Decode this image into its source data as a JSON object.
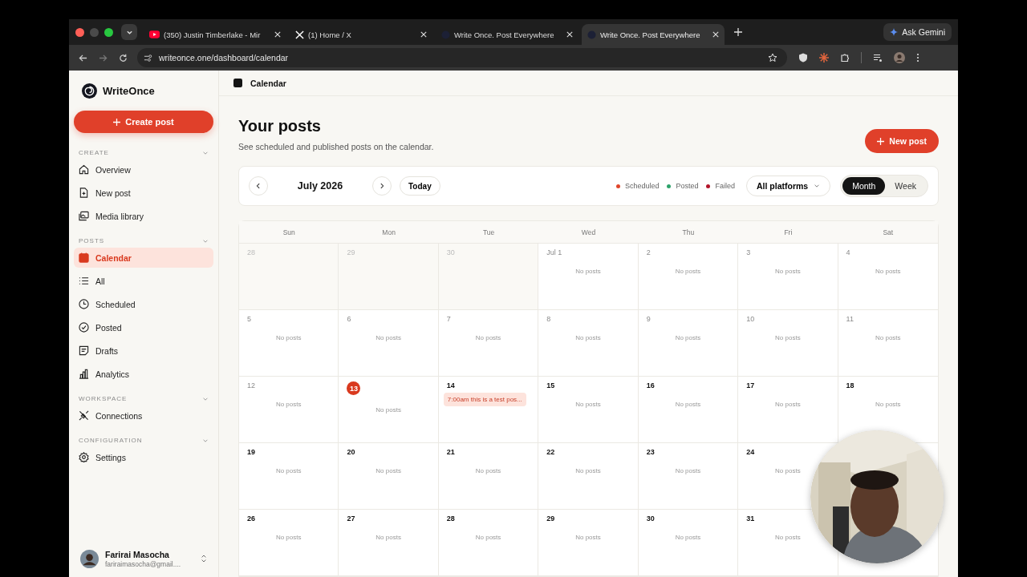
{
  "browser": {
    "tabs": [
      {
        "title": "(350) Justin Timberlake - Mir",
        "kind": "video",
        "selected": false
      },
      {
        "title": "(1) Home / X",
        "kind": "x",
        "selected": false
      },
      {
        "title": "Write Once. Post Everywhere",
        "kind": "app",
        "selected": false
      },
      {
        "title": "Write Once. Post Everywhere",
        "kind": "app",
        "selected": true
      }
    ],
    "gemini_button": "Ask Gemini",
    "url": "writeonce.one/dashboard/calendar"
  },
  "sidebar": {
    "brand": "WriteOnce",
    "create_button": "Create post",
    "sections": [
      {
        "title": "CREATE",
        "items": [
          {
            "label": "Overview",
            "selected": false
          },
          {
            "label": "New post",
            "selected": false
          },
          {
            "label": "Media library",
            "selected": false
          }
        ]
      },
      {
        "title": "POSTS",
        "items": [
          {
            "label": "Calendar",
            "selected": true
          },
          {
            "label": "All",
            "selected": false
          },
          {
            "label": "Scheduled",
            "selected": false
          },
          {
            "label": "Posted",
            "selected": false
          },
          {
            "label": "Drafts",
            "selected": false
          },
          {
            "label": "Analytics",
            "selected": false
          }
        ]
      },
      {
        "title": "WORKSPACE",
        "items": [
          {
            "label": "Connections",
            "selected": false
          }
        ]
      },
      {
        "title": "CONFIGURATION",
        "items": [
          {
            "label": "Settings",
            "selected": false
          }
        ]
      }
    ],
    "user": {
      "name": "Farirai Masocha",
      "email": "fariraimasocha@gmail...."
    }
  },
  "header": {
    "title": "Calendar"
  },
  "page": {
    "title": "Your posts",
    "subtitle": "See scheduled and published posts on the calendar.",
    "new_post_button": "New post"
  },
  "toolbar": {
    "month": "July 2026",
    "today_button": "Today",
    "legend": [
      {
        "label": "Scheduled",
        "color": "#e0452b"
      },
      {
        "label": "Posted",
        "color": "#2ea36b"
      },
      {
        "label": "Failed",
        "color": "#b3152a"
      }
    ],
    "platform_filter": "All platforms",
    "views": [
      {
        "label": "Month",
        "selected": true
      },
      {
        "label": "Week",
        "selected": false
      }
    ]
  },
  "calendar": {
    "weekdays": [
      "Sun",
      "Mon",
      "Tue",
      "Wed",
      "Thu",
      "Fri",
      "Sat"
    ],
    "weeks": [
      [
        {
          "day": "28",
          "outside_month": true
        },
        {
          "day": "29",
          "outside_month": true
        },
        {
          "day": "30",
          "outside_month": true
        },
        {
          "day": "Jul 1",
          "outside_month": false,
          "past": true,
          "empty_text": "No posts"
        },
        {
          "day": "2",
          "outside_month": false,
          "past": true,
          "empty_text": "No posts"
        },
        {
          "day": "3",
          "outside_month": false,
          "past": true,
          "empty_text": "No posts"
        },
        {
          "day": "4",
          "outside_month": false,
          "past": true,
          "empty_text": "No posts"
        }
      ],
      [
        {
          "day": "5",
          "outside_month": false,
          "past": true,
          "empty_text": "No posts"
        },
        {
          "day": "6",
          "outside_month": false,
          "past": true,
          "empty_text": "No posts"
        },
        {
          "day": "7",
          "outside_month": false,
          "past": true,
          "empty_text": "No posts"
        },
        {
          "day": "8",
          "outside_month": false,
          "past": true,
          "empty_text": "No posts"
        },
        {
          "day": "9",
          "outside_month": false,
          "past": true,
          "empty_text": "No posts"
        },
        {
          "day": "10",
          "outside_month": false,
          "past": true,
          "empty_text": "No posts"
        },
        {
          "day": "11",
          "outside_month": false,
          "past": true,
          "empty_text": "No posts"
        }
      ],
      [
        {
          "day": "12",
          "outside_month": false,
          "past": true,
          "empty_text": "No posts"
        },
        {
          "day": "13",
          "outside_month": false,
          "today": true,
          "empty_text": "No posts"
        },
        {
          "day": "14",
          "outside_month": false,
          "past": false,
          "posts": [
            "7:00am this is a test pos..."
          ]
        },
        {
          "day": "15",
          "outside_month": false,
          "past": false,
          "empty_text": "No posts"
        },
        {
          "day": "16",
          "outside_month": false,
          "past": false,
          "empty_text": "No posts"
        },
        {
          "day": "17",
          "outside_month": false,
          "past": false,
          "empty_text": "No posts"
        },
        {
          "day": "18",
          "outside_month": false,
          "past": false,
          "empty_text": "No posts"
        }
      ],
      [
        {
          "day": "19",
          "outside_month": false,
          "past": false,
          "empty_text": "No posts"
        },
        {
          "day": "20",
          "outside_month": false,
          "past": false,
          "empty_text": "No posts"
        },
        {
          "day": "21",
          "outside_month": false,
          "past": false,
          "empty_text": "No posts"
        },
        {
          "day": "22",
          "outside_month": false,
          "past": false,
          "empty_text": "No posts"
        },
        {
          "day": "23",
          "outside_month": false,
          "past": false,
          "empty_text": "No posts"
        },
        {
          "day": "24",
          "outside_month": false,
          "past": false,
          "empty_text": "No posts"
        }
      ],
      [
        {
          "day": "26",
          "outside_month": false,
          "past": false,
          "empty_text": "No posts"
        },
        {
          "day": "27",
          "outside_month": false,
          "past": false,
          "empty_text": "No posts"
        },
        {
          "day": "28",
          "outside_month": false,
          "past": false,
          "empty_text": "No posts"
        },
        {
          "day": "29",
          "outside_month": false,
          "past": false,
          "empty_text": "No posts"
        },
        {
          "day": "30",
          "outside_month": false,
          "past": false,
          "empty_text": "No posts"
        },
        {
          "day": "31",
          "outside_month": false,
          "past": false,
          "empty_text": "No posts"
        }
      ]
    ]
  }
}
